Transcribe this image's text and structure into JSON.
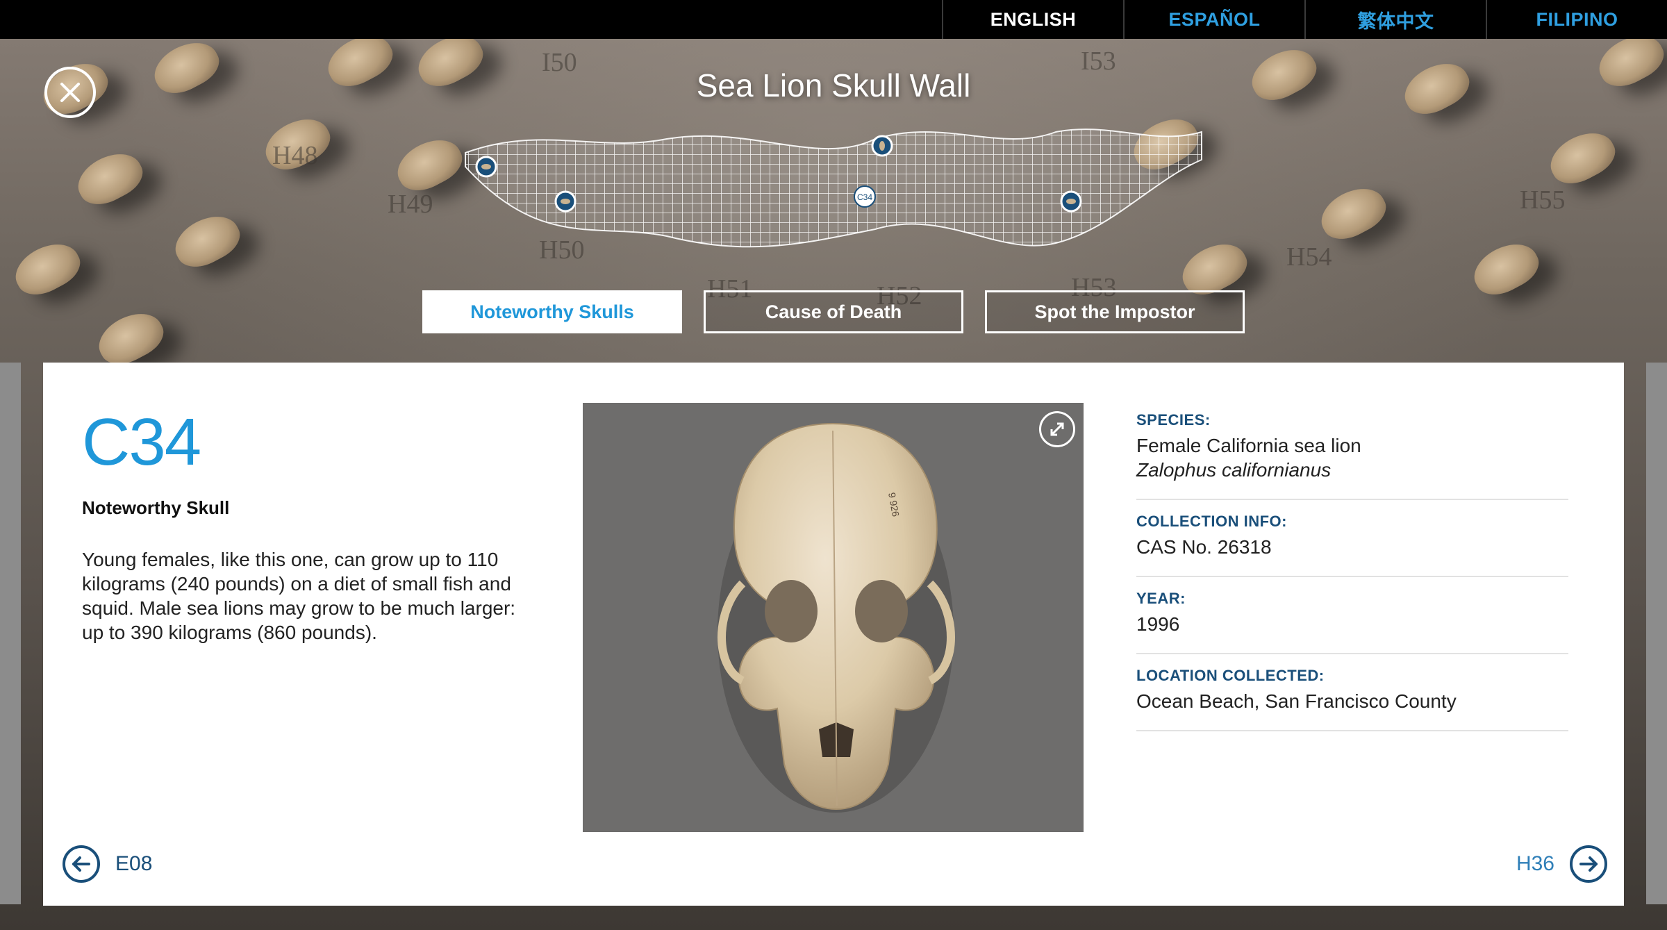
{
  "languages": [
    {
      "label": "ENGLISH",
      "active": true
    },
    {
      "label": "ESPAÑOL",
      "active": false
    },
    {
      "label": "繁体中文",
      "active": false
    },
    {
      "label": "FILIPINO",
      "active": false
    }
  ],
  "header": {
    "title": "Sea Lion Skull Wall",
    "close_icon": "close-icon"
  },
  "wall_tags": [
    "I50",
    "I53",
    "H49",
    "H50",
    "H51",
    "H55",
    "H54",
    "H52",
    "H53",
    "H48"
  ],
  "skull_map": {
    "selected_label": "C34",
    "marker_icons": [
      "skull-marker-icon",
      "skull-marker-icon",
      "skull-marker-icon",
      "skull-marker-icon"
    ]
  },
  "tabs": [
    {
      "label": "Noteworthy Skulls",
      "active": true
    },
    {
      "label": "Cause of Death",
      "active": false
    },
    {
      "label": "Spot the Impostor",
      "active": false
    }
  ],
  "detail": {
    "id": "C34",
    "kind": "Noteworthy Skull",
    "description": "Young females, like this one, can grow up to 110 kilograms (240 pounds) on a diet of small fish and squid. Male sea lions may grow to be much larger: up to 390 kilograms (860 pounds).",
    "image_icon": "sea-lion-skull-photo",
    "expand_icon": "expand-icon",
    "specimen_mark": "9 926"
  },
  "info": {
    "species_label": "SPECIES:",
    "species_common": "Female California sea lion",
    "species_latin": "Zalophus californianus",
    "collection_label": "COLLECTION INFO:",
    "collection_value": "CAS No. 26318",
    "year_label": "YEAR:",
    "year_value": "1996",
    "location_label": "LOCATION COLLECTED:",
    "location_value": "Ocean Beach, San Francisco County"
  },
  "nav": {
    "prev_label": "E08",
    "next_label": "H36",
    "prev_icon": "arrow-left-icon",
    "next_icon": "arrow-right-icon"
  },
  "colors": {
    "accent_blue": "#1f97d9",
    "navy": "#1a4f7a",
    "lang_bar": "#000000",
    "photo_bg": "#6e6d6c"
  }
}
